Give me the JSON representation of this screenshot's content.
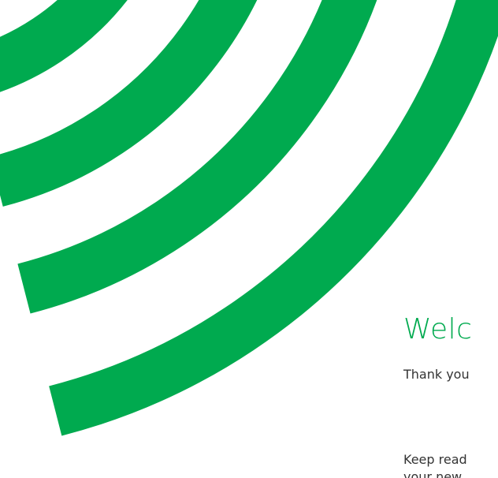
{
  "colors": {
    "accent": "#00AA4F",
    "text": "#333333",
    "background": "#FFFFFF"
  },
  "decoration": {
    "name": "concentric-green-arcs",
    "band_count": 4
  },
  "content": {
    "title": "Welc",
    "thank_you_line": "Thank you",
    "keep_reading_line1": "Keep read",
    "keep_reading_line2": "your new"
  }
}
